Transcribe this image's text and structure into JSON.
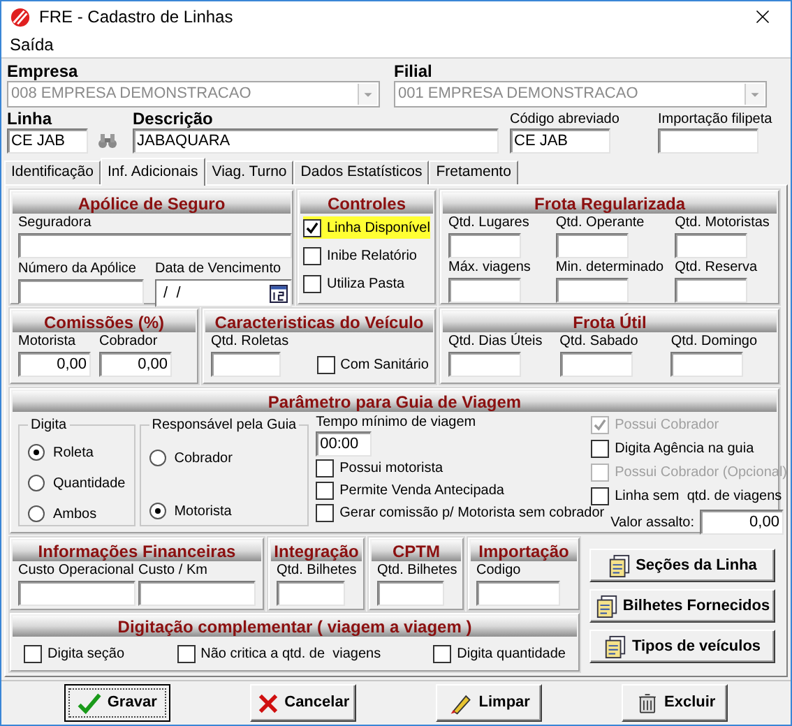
{
  "window": {
    "title": "FRE - Cadastro de Linhas"
  },
  "menu": [
    {
      "label": "Saída"
    }
  ],
  "header": {
    "empresa": {
      "label": "Empresa",
      "value": "008 EMPRESA DEMONSTRACAO",
      "disabled": true
    },
    "filial": {
      "label": "Filial",
      "value": "001 EMPRESA DEMONSTRACAO",
      "disabled": true
    },
    "linha": {
      "label": "Linha",
      "value": "CE JAB"
    },
    "descricao": {
      "label": "Descrição",
      "value": "JABAQUARA"
    },
    "codigo": {
      "label": "Código abreviado",
      "value": "CE JAB"
    },
    "importacao": {
      "label": "Importação filipeta"
    }
  },
  "tabs": [
    {
      "label": "Identificação",
      "selected": false
    },
    {
      "label": "Inf. Adicionais",
      "selected": true
    },
    {
      "label": "Viag. Turno",
      "selected": false
    },
    {
      "label": "Dados Estatísticos",
      "selected": false
    },
    {
      "label": "Fretamento",
      "selected": false
    }
  ],
  "apolice": {
    "title": "Apólice de Seguro",
    "seguradora": {
      "label": "Seguradora"
    },
    "numero": {
      "label": "Número da Apólice"
    },
    "vencimento": {
      "label": "Data de Vencimento",
      "value": " /  /"
    }
  },
  "controles": {
    "title": "Controles",
    "items": [
      {
        "label": "Linha Disponível",
        "checked": true,
        "highlighted": true
      },
      {
        "label": "Inibe Relatório",
        "checked": false,
        "highlighted": false
      },
      {
        "label": "Utiliza Pasta",
        "checked": false,
        "highlighted": false
      }
    ]
  },
  "frota_regularizada": {
    "title": "Frota Regularizada",
    "fields": [
      {
        "label": "Qtd. Lugares"
      },
      {
        "label": "Qtd. Operante"
      },
      {
        "label": "Qtd. Motoristas"
      },
      {
        "label": "Máx. viagens"
      },
      {
        "label": "Min. determinado"
      },
      {
        "label": "Qtd. Reserva"
      }
    ]
  },
  "comissoes": {
    "title": "Comissões (%)",
    "fields": [
      {
        "label": "Motorista",
        "value": "0,00"
      },
      {
        "label": "Cobrador",
        "value": "0,00"
      }
    ]
  },
  "veiculo": {
    "title": "Caracteristicas do Veículo",
    "roletas": {
      "label": "Qtd. Roletas"
    },
    "sanitario": {
      "label": "Com Sanitário",
      "checked": false
    }
  },
  "frota_util": {
    "title": "Frota Útil",
    "fields": [
      {
        "label": "Qtd. Dias Úteis"
      },
      {
        "label": "Qtd. Sabado"
      },
      {
        "label": "Qtd. Domingo"
      }
    ]
  },
  "parametro": {
    "title": "Parâmetro para Guia de Viagem",
    "digita": {
      "legend": "Digita",
      "options": [
        {
          "label": "Roleta",
          "selected": true
        },
        {
          "label": "Quantidade",
          "selected": false
        },
        {
          "label": "Ambos",
          "selected": false
        }
      ]
    },
    "responsavel": {
      "legend": "Responsável pela Guia",
      "options": [
        {
          "label": "Cobrador",
          "selected": false
        },
        {
          "label": "Motorista",
          "selected": true
        }
      ]
    },
    "tempo": {
      "label": "Tempo mínimo de viagem",
      "value": "00:00"
    },
    "middle_checks": [
      {
        "label": "Possui motorista",
        "checked": false,
        "disabled": false
      },
      {
        "label": "Permite Venda Antecipada",
        "checked": false,
        "disabled": false
      },
      {
        "label": "Gerar comissão p/ Motorista sem cobrador",
        "checked": false,
        "disabled": false
      }
    ],
    "right_checks": [
      {
        "label": "Possui Cobrador",
        "checked": true,
        "disabled": true
      },
      {
        "label": "Digita Agência na guia",
        "checked": false,
        "disabled": false
      },
      {
        "label": "Possui Cobrador (Opcional)",
        "checked": false,
        "disabled": true
      },
      {
        "label": "Linha sem  qtd. de viagens",
        "checked": false,
        "disabled": false
      }
    ],
    "valor_assalto": {
      "label": "Valor assalto:",
      "value": "0,00"
    }
  },
  "financeiras": {
    "title": "Informações Financeiras",
    "fields": [
      {
        "label": "Custo Operacional"
      },
      {
        "label": "Custo / Km"
      }
    ]
  },
  "integracao": {
    "title": "Integração",
    "fields": [
      {
        "label": "Qtd. Bilhetes"
      }
    ]
  },
  "cptm": {
    "title": "CPTM",
    "fields": [
      {
        "label": "Qtd. Bilhetes"
      }
    ]
  },
  "importacao": {
    "title": "Importação",
    "fields": [
      {
        "label": "Codigo"
      }
    ]
  },
  "complementar": {
    "title": "Digitação complementar ( viagem a viagem )",
    "items": [
      {
        "label": "Digita seção",
        "checked": false
      },
      {
        "label": "Não critica a qtd. de  viagens",
        "checked": false
      },
      {
        "label": "Digita quantidade",
        "checked": false
      }
    ]
  },
  "side_buttons": [
    {
      "label": "Seções da Linha"
    },
    {
      "label": "Bilhetes Fornecidos"
    },
    {
      "label": "Tipos de veículos"
    }
  ],
  "footer_buttons": [
    {
      "label": "Gravar",
      "kind": "save",
      "focused": true
    },
    {
      "label": "Cancelar",
      "kind": "cancel",
      "focused": false
    },
    {
      "label": "Limpar",
      "kind": "clear",
      "focused": false
    },
    {
      "label": "Excluir",
      "kind": "delete",
      "focused": false
    }
  ]
}
